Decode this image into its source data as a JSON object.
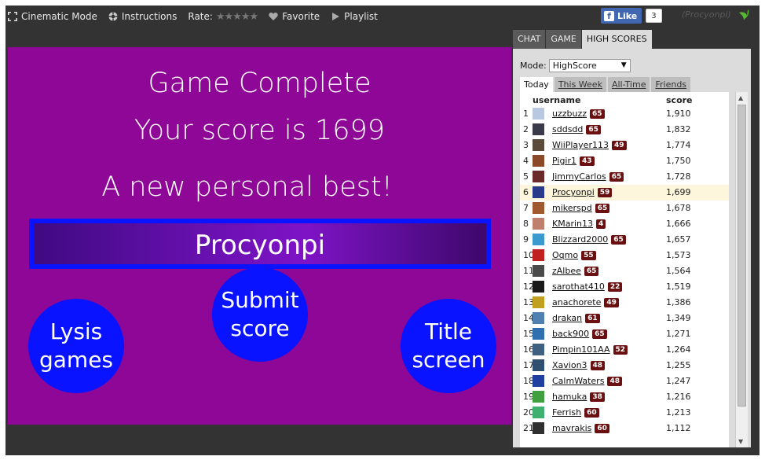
{
  "toolbar": {
    "cinematic": "Cinematic Mode",
    "instructions": "Instructions",
    "rate": "Rate:",
    "stars": "★★★★★",
    "favorite": "Favorite",
    "playlist": "Playlist"
  },
  "facebook": {
    "like": "Like",
    "count": "3"
  },
  "user": {
    "name": "(Procyonpi)"
  },
  "game": {
    "title": "Game Complete",
    "score_line": "Your score is 1699",
    "best_line": "A new personal best!",
    "player_name": "Procyonpi",
    "buttons": {
      "lysis": [
        "Lysis",
        "games"
      ],
      "submit": [
        "Submit",
        "score"
      ],
      "title": [
        "Title",
        "screen"
      ]
    }
  },
  "panel": {
    "tabs": [
      "CHAT",
      "GAME",
      "HIGH SCORES"
    ],
    "mode_label": "Mode:",
    "mode_value": "HighScore",
    "periods": [
      "Today",
      "This Week",
      "All-Time",
      "Friends"
    ],
    "columns": {
      "username": "username",
      "score": "score"
    },
    "rows": [
      {
        "rank": "1",
        "name": "uzzbuzz",
        "level": "65",
        "score": "1,910"
      },
      {
        "rank": "2",
        "name": "sddsdd",
        "level": "65",
        "score": "1,832"
      },
      {
        "rank": "3",
        "name": "WiiPlayer113",
        "level": "49",
        "score": "1,774"
      },
      {
        "rank": "4",
        "name": "Pigir1",
        "level": "43",
        "score": "1,750"
      },
      {
        "rank": "5",
        "name": "JimmyCarlos",
        "level": "65",
        "score": "1,728"
      },
      {
        "rank": "6",
        "name": "Procyonpi",
        "level": "59",
        "score": "1,699"
      },
      {
        "rank": "7",
        "name": "mikerspd",
        "level": "65",
        "score": "1,678"
      },
      {
        "rank": "8",
        "name": "KMarin13",
        "level": "4",
        "score": "1,666"
      },
      {
        "rank": "9",
        "name": "Blizzard2000",
        "level": "65",
        "score": "1,657"
      },
      {
        "rank": "10",
        "name": "Oqmo",
        "level": "55",
        "score": "1,573"
      },
      {
        "rank": "11",
        "name": "zAlbee",
        "level": "65",
        "score": "1,564"
      },
      {
        "rank": "12",
        "name": "sarothat410",
        "level": "22",
        "score": "1,519"
      },
      {
        "rank": "13",
        "name": "anachorete",
        "level": "49",
        "score": "1,386"
      },
      {
        "rank": "14",
        "name": "drakan",
        "level": "61",
        "score": "1,349"
      },
      {
        "rank": "15",
        "name": "back900",
        "level": "65",
        "score": "1,271"
      },
      {
        "rank": "16",
        "name": "Pimpin101AA",
        "level": "52",
        "score": "1,264"
      },
      {
        "rank": "17",
        "name": "Xavion3",
        "level": "48",
        "score": "1,255"
      },
      {
        "rank": "18",
        "name": "CalmWaters",
        "level": "48",
        "score": "1,247"
      },
      {
        "rank": "19",
        "name": "hamuka",
        "level": "38",
        "score": "1,216"
      },
      {
        "rank": "20",
        "name": "Ferrish",
        "level": "60",
        "score": "1,213"
      },
      {
        "rank": "21",
        "name": "mavrakis",
        "level": "60",
        "score": "1,112"
      }
    ],
    "avatar_colors": [
      "#b9c8e0",
      "#3a3a4a",
      "#5a4a3a",
      "#8a4a2a",
      "#6a2a2a",
      "#2a3a8a",
      "#a05a30",
      "#c08070",
      "#3a9ad0",
      "#c02020",
      "#4a4a4a",
      "#1a1a1a",
      "#c0a020",
      "#5080b0",
      "#3070b0",
      "#406080",
      "#305070",
      "#2040a0",
      "#40a040",
      "#40b070",
      "#303030"
    ]
  }
}
